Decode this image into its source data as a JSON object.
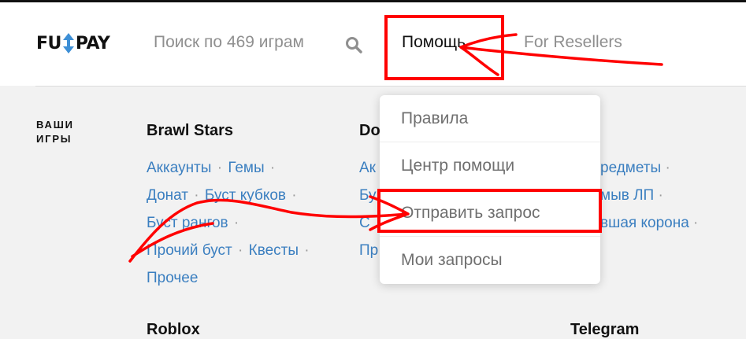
{
  "header": {
    "logo_left": "FU",
    "logo_right": "PAY",
    "search_placeholder": "Поиск по 469 играм",
    "nav_help": "Помощь",
    "nav_resellers": "For Resellers"
  },
  "dropdown": {
    "items": [
      "Правила",
      "Центр помощи",
      "Отправить запрос",
      "Мои запросы"
    ]
  },
  "sidebar": {
    "your_games_line1": "ВАШИ",
    "your_games_line2": "ИГРЫ"
  },
  "games": {
    "brawl": {
      "title": "Brawl Stars",
      "links": [
        "Аккаунты",
        "Гемы",
        "Донат",
        "Буст кубков",
        "Буст рангов",
        "Прочий буст",
        "Квесты",
        "Прочее"
      ]
    },
    "dota": {
      "title_partial": "Do",
      "frags": [
        "Ак",
        "Бу",
        "С",
        "Пр"
      ]
    },
    "right_col": {
      "frags": [
        "редметы",
        "мыв ЛП",
        "вшая корона"
      ]
    },
    "next_row": {
      "left_title": "Roblox",
      "right_title": "Telegram"
    }
  },
  "colors": {
    "link": "#3b7fc0",
    "annotation": "#ff0000",
    "logo_arrow": "#3d8fd6"
  }
}
